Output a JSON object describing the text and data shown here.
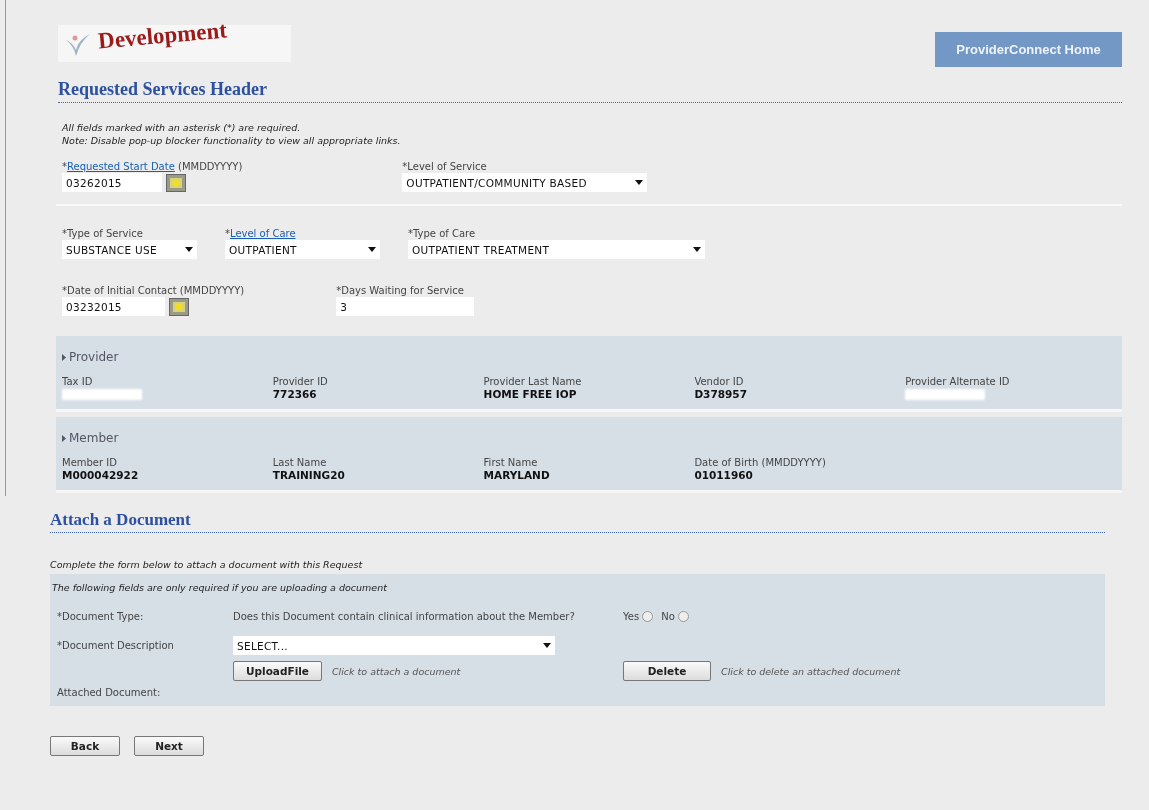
{
  "logo": {
    "stamp": "Development"
  },
  "home_button": "ProviderConnect Home",
  "header": {
    "title": "Requested Services Header",
    "notes": [
      "All fields marked with an asterisk (*) are required.",
      "Note: Disable pop-up blocker functionality to view all appropriate links."
    ]
  },
  "field_rows": [
    [
      {
        "kind": "date",
        "prefix": "*",
        "link": "Requested Start Date",
        "label": "(MMDDYYYY)",
        "value": "03262015"
      },
      {
        "kind": "select",
        "prefix": "*",
        "label": "Level of Service",
        "value": "OUTPATIENT/COMMUNITY BASED"
      }
    ],
    [
      {
        "kind": "select",
        "prefix": "*",
        "label": "Type of Service",
        "value": "SUBSTANCE USE"
      },
      {
        "kind": "select",
        "prefix": "*",
        "link": "Level of Care",
        "value": "OUTPATIENT"
      },
      {
        "kind": "select",
        "prefix": "*",
        "label": "Type of Care",
        "value": "OUTPATIENT TREATMENT"
      }
    ],
    [
      {
        "kind": "date",
        "prefix": "*",
        "label": "Date of Initial Contact (MMDDYYYY)",
        "value": "03232015"
      },
      {
        "kind": "text",
        "prefix": "*",
        "label": "Days Waiting for Service",
        "value": "3"
      }
    ]
  ],
  "panels": [
    {
      "title": "Provider",
      "columns": [
        {
          "label": "Tax ID",
          "redacted": true
        },
        {
          "label": "Provider ID",
          "value": "772366",
          "redacted": false
        },
        {
          "label": "Provider Last Name",
          "value": "HOME FREE IOP",
          "redacted": false
        },
        {
          "label": "Vendor ID",
          "value": "D378957",
          "redacted": false
        },
        {
          "label": "Provider Alternate ID",
          "redacted": true
        }
      ]
    },
    {
      "title": "Member",
      "columns": [
        {
          "label": "Member ID",
          "value": "M000042922",
          "redacted": false
        },
        {
          "label": "Last Name",
          "value": "TRAINING20",
          "redacted": false
        },
        {
          "label": "First Name",
          "value": "MARYLAND",
          "redacted": false
        },
        {
          "label": "Date of Birth (MMDDYYYY)",
          "value": "01011960",
          "redacted": false
        }
      ]
    }
  ],
  "attach": {
    "title": "Attach a Document",
    "intro": "Complete the form below to attach a document with this Request",
    "note": "The following fields are only required if you are uploading a document",
    "document_type": {
      "label": "*Document Type:",
      "question": "Does this Document contain clinical information about the Member?",
      "options": [
        {
          "label": "Yes",
          "selected": false
        },
        {
          "label": "No",
          "selected": false
        }
      ]
    },
    "document_description": {
      "label": "*Document Description",
      "value": "SELECT..."
    },
    "upload": {
      "button": "UploadFile",
      "hint": "Click to attach a document"
    },
    "delete": {
      "button": "Delete",
      "hint": "Click to delete an attached document"
    },
    "attached_label": "Attached Document:"
  },
  "footer_buttons": [
    "Back",
    "Next"
  ]
}
